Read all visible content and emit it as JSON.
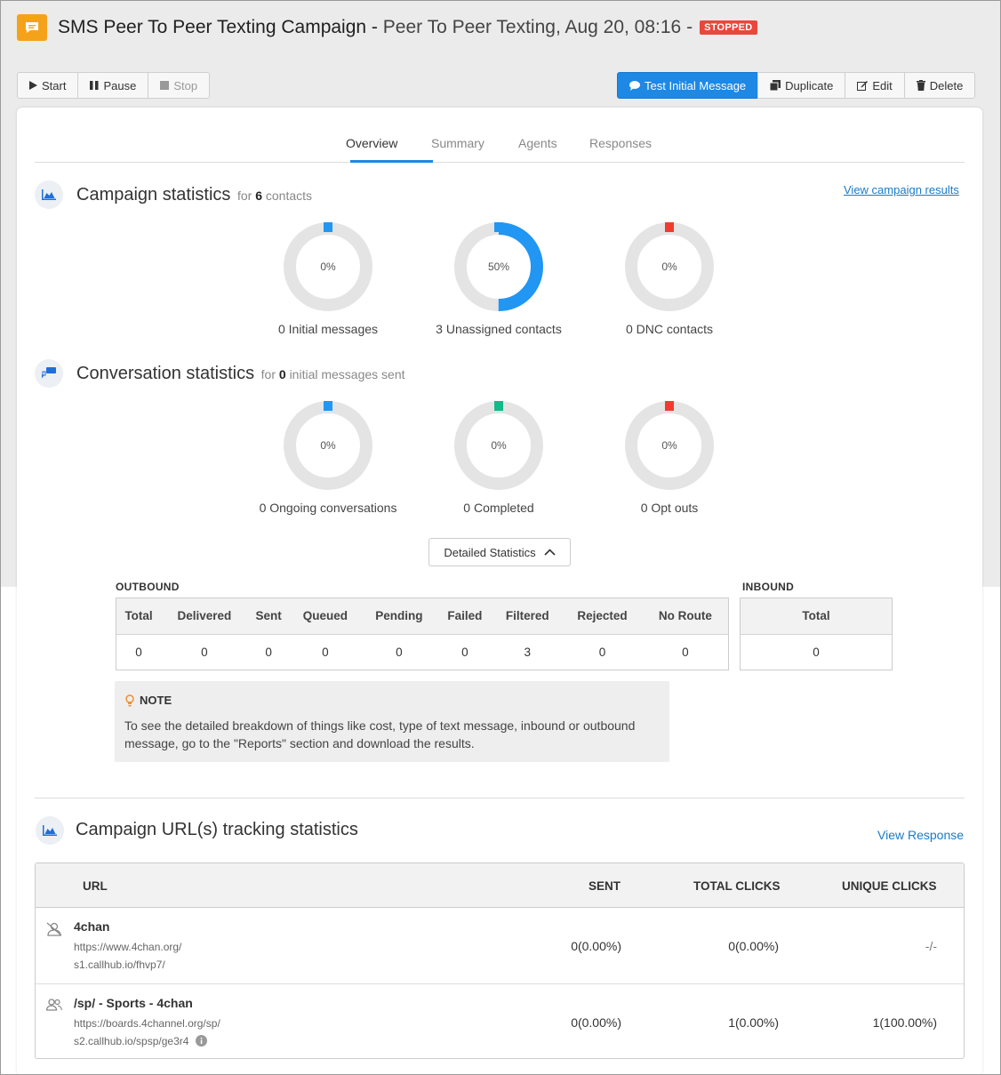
{
  "header": {
    "title": "SMS Peer To Peer Texting Campaign",
    "separator": "-",
    "subtitle": "Peer To Peer Texting, Aug 20, 08:16 -",
    "status": "STOPPED"
  },
  "toolbar": {
    "start": "Start",
    "pause": "Pause",
    "stop": "Stop",
    "test_message": "Test Initial Message",
    "duplicate": "Duplicate",
    "edit": "Edit",
    "delete": "Delete"
  },
  "tabs": [
    "Overview",
    "Summary",
    "Agents",
    "Responses"
  ],
  "campaign_stats": {
    "title": "Campaign statistics",
    "for_prefix": "for",
    "count": "6",
    "for_suffix": "contacts",
    "link": "View campaign results",
    "donuts": [
      {
        "pct": "0%",
        "value": 0,
        "label": "0 Initial messages",
        "color": "#2196f3"
      },
      {
        "pct": "50%",
        "value": 0.5,
        "label": "3 Unassigned contacts",
        "color": "#2196f3"
      },
      {
        "pct": "0%",
        "value": 0,
        "label": "0 DNC contacts",
        "color": "#f23b2f"
      }
    ]
  },
  "conversation_stats": {
    "title": "Conversation statistics",
    "for_prefix": "for",
    "count": "0",
    "for_suffix": "initial messages sent",
    "donuts": [
      {
        "pct": "0%",
        "value": 0,
        "label": "0 Ongoing conversations",
        "color": "#2196f3"
      },
      {
        "pct": "0%",
        "value": 0,
        "label": "0 Completed",
        "color": "#14b88a"
      },
      {
        "pct": "0%",
        "value": 0,
        "label": "0 Opt outs",
        "color": "#f23b2f"
      }
    ]
  },
  "detailed_button": "Detailed Statistics",
  "outbound": {
    "label": "OUTBOUND",
    "headers": [
      "Total",
      "Delivered",
      "Sent",
      "Queued",
      "Pending",
      "Failed",
      "Filtered",
      "Rejected",
      "No Route"
    ],
    "values": [
      "0",
      "0",
      "0",
      "0",
      "0",
      "0",
      "3",
      "0",
      "0"
    ]
  },
  "inbound": {
    "label": "INBOUND",
    "headers": [
      "Total"
    ],
    "values": [
      "0"
    ]
  },
  "note": {
    "title": "NOTE",
    "text": "To see the detailed breakdown of things like cost, type of text message, inbound or outbound message, go to the \"Reports\" section and download the results."
  },
  "url_stats": {
    "title": "Campaign URL(s) tracking statistics",
    "link": "View Response",
    "headers": {
      "url": "URL",
      "sent": "SENT",
      "total": "TOTAL CLICKS",
      "unique": "UNIQUE CLICKS"
    },
    "rows": [
      {
        "name": "4chan",
        "url": "https://www.4chan.org/",
        "short": "s1.callhub.io/fhvp7/",
        "sent": "0(0.00%)",
        "total": "0(0.00%)",
        "unique": "-/-",
        "icon": "no-user-icon"
      },
      {
        "name": "/sp/ - Sports - 4chan",
        "url": "https://boards.4channel.org/sp/",
        "short": "s2.callhub.io/spsp/ge3r4",
        "sent": "0(0.00%)",
        "total": "1(0.00%)",
        "unique": "1(100.00%)",
        "icon": "users-icon"
      }
    ]
  }
}
